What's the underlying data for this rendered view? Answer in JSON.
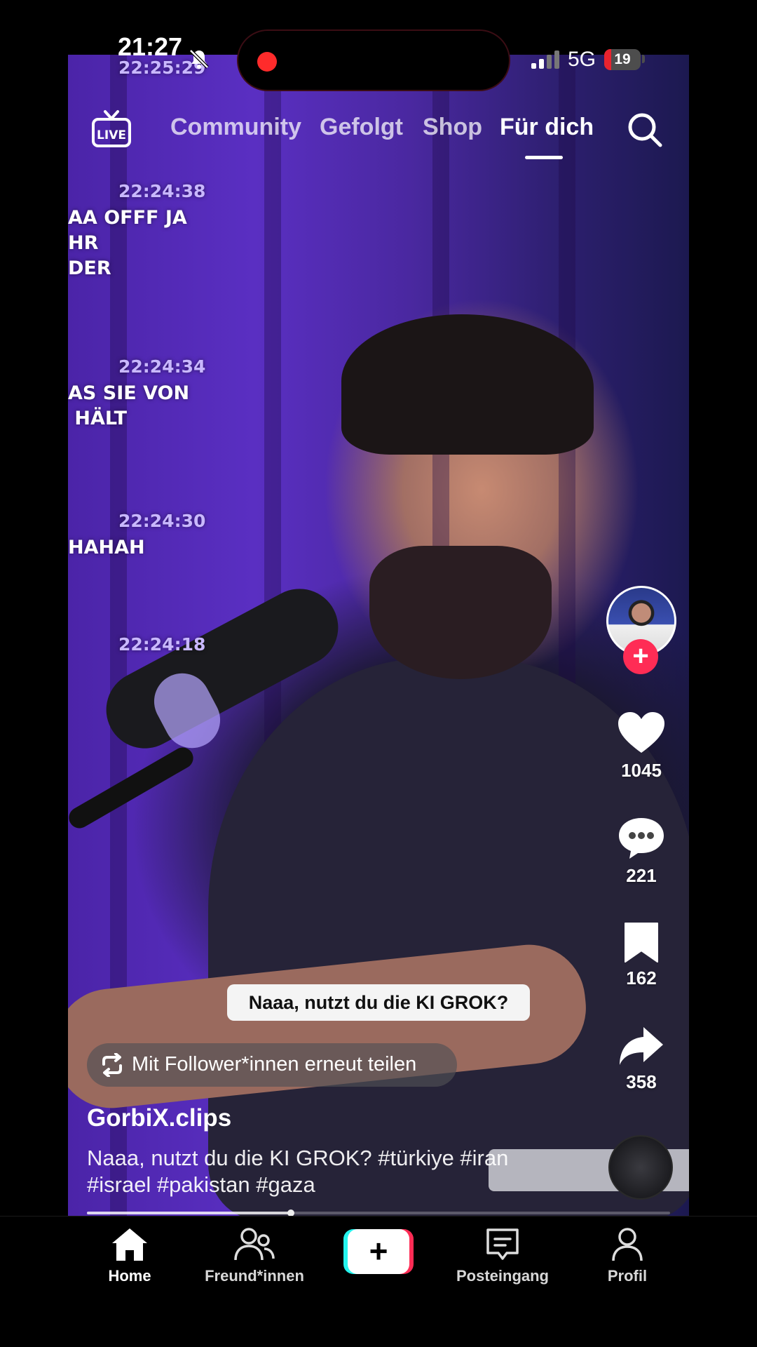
{
  "status_bar": {
    "time": "21:27",
    "network": "5G",
    "battery_level": "19",
    "battery_percent": 19,
    "battery_color": "#e8232e",
    "recording_dot_color": "#ff2b2b",
    "icons": [
      "bell-slash-icon",
      "signal-icon"
    ]
  },
  "video": {
    "chat_overlay": [
      {
        "time": "22:25:29",
        "message": ""
      },
      {
        "time": "22:24:38",
        "message": "AA OFFF JA\nHR\nDER"
      },
      {
        "time": "22:24:34",
        "message": "AS SIE VON\n HÄLT"
      },
      {
        "time": "22:24:30",
        "message": "HAHAH"
      },
      {
        "time": "22:24:18",
        "message": ""
      }
    ],
    "caption": "Naaa, nutzt du die KI GROK?",
    "progress_fraction": 0.35
  },
  "top_nav": {
    "live_label": "LIVE",
    "tabs": [
      {
        "label": "Community",
        "active": false
      },
      {
        "label": "Gefolgt",
        "active": false
      },
      {
        "label": "Shop",
        "active": false
      },
      {
        "label": "Für dich",
        "active": true
      }
    ],
    "search_icon": "search-icon"
  },
  "right_rail": {
    "follow_symbol": "+",
    "likes": "1045",
    "comments": "221",
    "bookmarks": "162",
    "shares": "358",
    "like_icon": "heart-icon",
    "comment_icon": "comment-icon",
    "bookmark_icon": "bookmark-icon",
    "share_icon": "share-icon"
  },
  "post": {
    "repost_label": "Mit Follower*innen erneut teilen",
    "username": "GorbiX.clips",
    "description": "Naaa, nutzt du die KI GROK? #türkiye #iran #israel #pakistan #gaza"
  },
  "bottom_nav": {
    "items": [
      {
        "label": "Home",
        "icon": "home-icon",
        "active": true
      },
      {
        "label": "Freund*innen",
        "icon": "friends-icon",
        "active": false
      },
      {
        "label": "+",
        "icon": "create-icon",
        "active": false
      },
      {
        "label": "Posteingang",
        "icon": "inbox-icon",
        "active": false
      },
      {
        "label": "Profil",
        "icon": "profile-icon",
        "active": false
      }
    ],
    "brand_colors": {
      "cyan": "#25f4ee",
      "red": "#fe2c55"
    }
  }
}
